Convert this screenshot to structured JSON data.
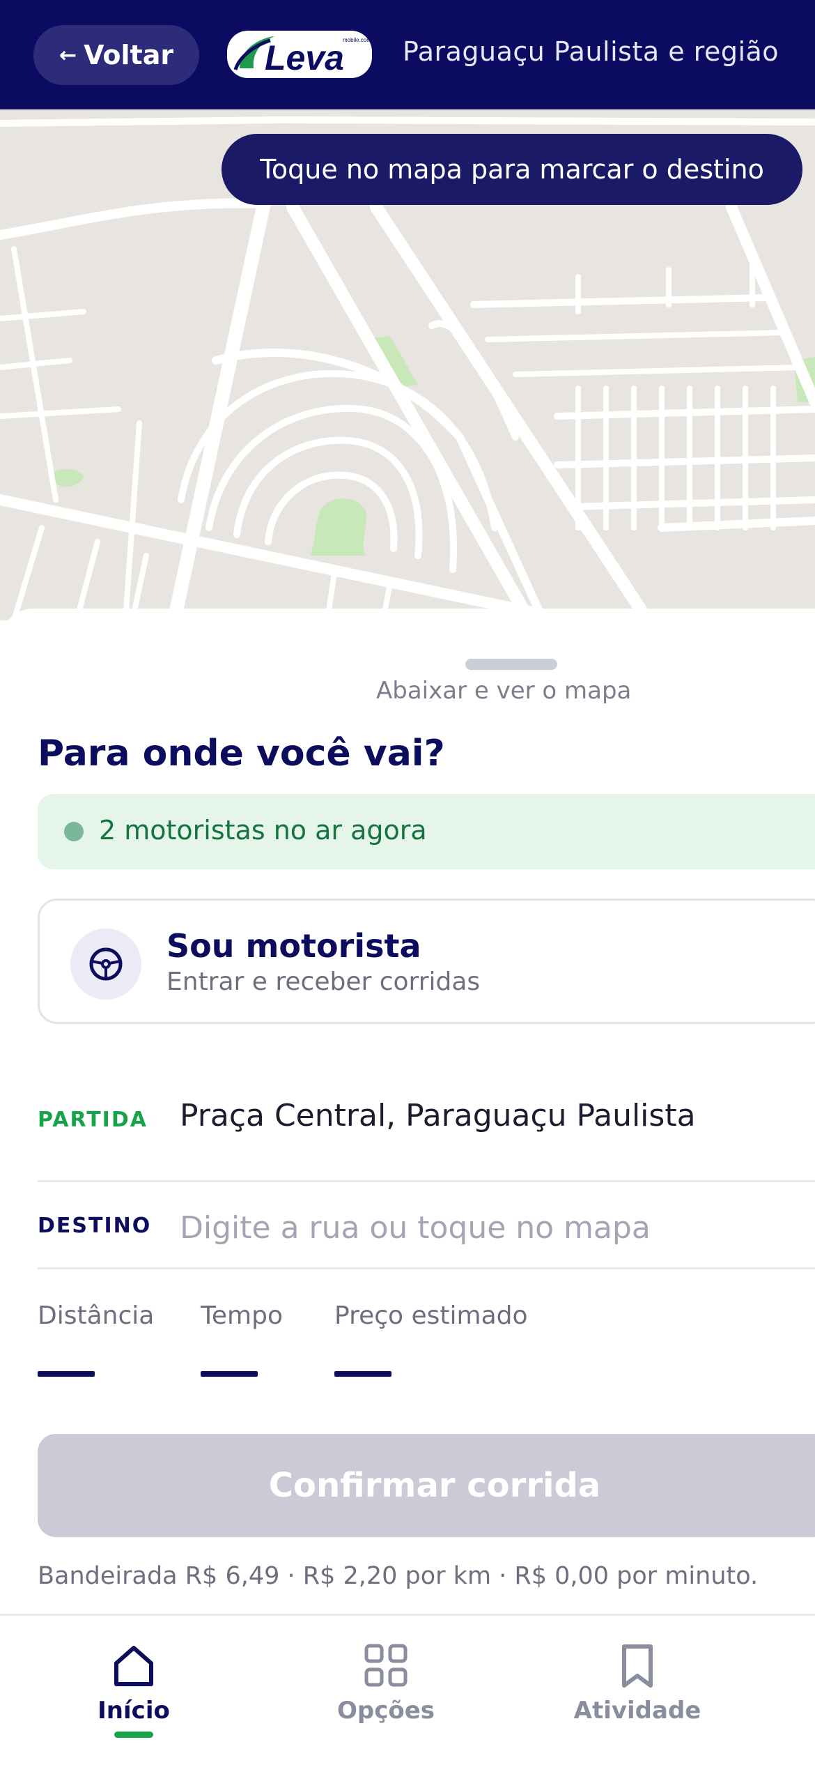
{
  "header": {
    "back_label": "Voltar",
    "logo_text": "Leva",
    "logo_small": "mobile.com",
    "region": "Paraguaçu Paulista e região"
  },
  "map": {
    "hint": "Toque no mapa para marcar o destino"
  },
  "sheet": {
    "handle_hint": "Abaixar e ver o mapa",
    "question": "Para onde você vai?",
    "drivers_online": "2 motoristas no ar agora",
    "driver_card": {
      "title": "Sou motorista",
      "subtitle": "Entrar e receber corridas"
    },
    "origin": {
      "label": "PARTIDA",
      "value": "Praça Central, Paraguaçu Paulista"
    },
    "destination": {
      "label": "DESTINO",
      "placeholder": "Digite a rua ou toque no mapa",
      "value": ""
    },
    "stats": [
      {
        "label": "Distância",
        "value": "—"
      },
      {
        "label": "Tempo",
        "value": "—"
      },
      {
        "label": "Preço estimado",
        "value": "—"
      }
    ],
    "confirm_label": "Confirmar corrida",
    "fare_note": "Bandeirada R$ 6,49 · R$ 2,20 por km · R$ 0,00 por minuto."
  },
  "nav": {
    "items": [
      {
        "label": "Início",
        "icon": "home-icon",
        "active": true
      },
      {
        "label": "Opções",
        "icon": "grid-icon",
        "active": false
      },
      {
        "label": "Atividade",
        "icon": "bookmark-icon",
        "active": false
      }
    ]
  },
  "colors": {
    "header_bg": "#0b0b62",
    "accent_green": "#16a34a",
    "primary_text": "#0d0d5e",
    "disabled_button": "#cbcbd8",
    "map_bg": "#e8e5e1"
  }
}
